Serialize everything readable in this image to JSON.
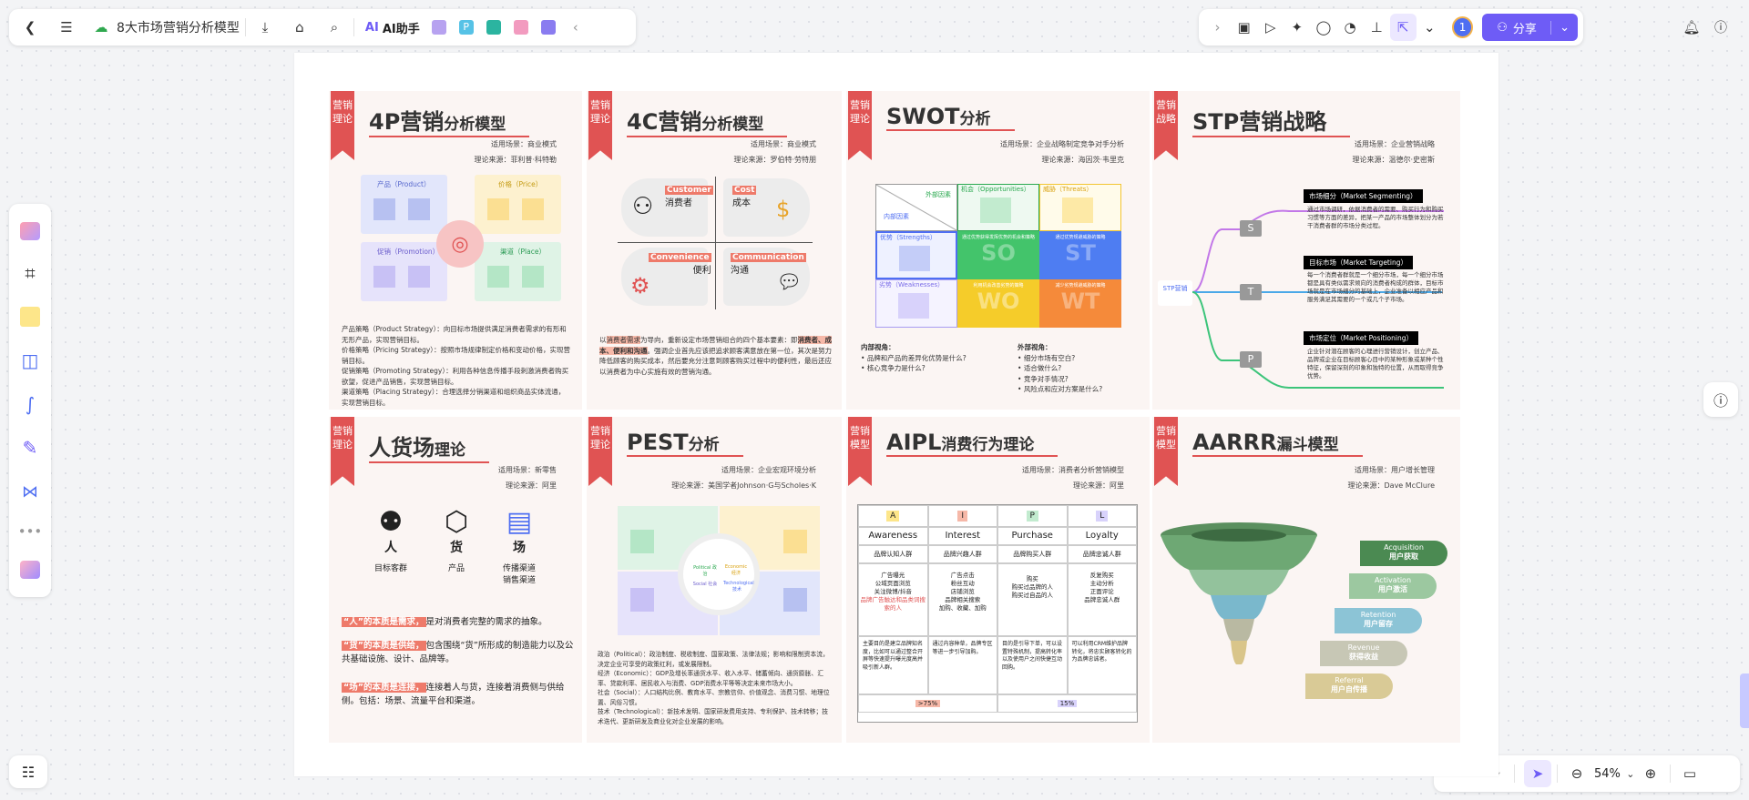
{
  "toolbar": {
    "doc_title": "8大市场营销分析模型",
    "ai_label": "AI助手",
    "share_label": "分享",
    "avatar_text": "1"
  },
  "zoom": {
    "level": "54%"
  },
  "cards": {
    "c1": {
      "ribbon": "营销理论",
      "title": "4P营销",
      "title_small": "分析模型",
      "meta1": "适用场景：商业模式",
      "meta2": "理论来源：菲利普·科特勒",
      "q1": "产品（Product）",
      "q2": "价格（Price）",
      "q3": "促销（Promotion）",
      "q4": "渠道（Place）",
      "d1": "产品策略（Product Strategy）：向目标市场提供满足消费者需求的有形和无形产品，实现营销目标。",
      "d2": "价格策略（Pricing Strategy）：按照市场规律制定价格和变动价格，实现营销目标。",
      "d3": "促销策略（Promoting Strategy）：利用各种信息传播手段刺激消费者购买欲望，促进产品销售，实现营销目标。",
      "d4": "渠道策略（Placing Strategy）：合理选择分销渠道和组织商品实体流通，实现营销目标。"
    },
    "c2": {
      "ribbon": "营销理论",
      "title": "4C营销",
      "title_small": "分析模型",
      "meta1": "适用场景：商业模式",
      "meta2": "理论来源：罗伯特·劳特朋",
      "q1en": "Customer",
      "q1": "消费者",
      "q2en": "Cost",
      "q2": "成本",
      "q3en": "Convenience",
      "q3": "便利",
      "q4en": "Communication",
      "q4": "沟通",
      "d_pre": "以",
      "d_h1": "消费者需求",
      "d_mid": "为导向，重新设定市场营销组合的四个基本要素：即",
      "d_h2": "消费者、成本、便利和沟通",
      "d_post": "。强调企业首先应该把追求顾客满意放在第一位，其次是努力降低顾客的购买成本，然后要充分注意到顾客购买过程中的便利性，最后还应以消费者为中心实施有效的营销沟通。"
    },
    "c3": {
      "ribbon": "营销理论",
      "title": "SWOT",
      "title_small": "分析",
      "meta1": "适用场景：企业战略制定竞争对手分析",
      "meta2": "理论来源：海因茨·韦里克",
      "ext": "外部因素",
      "int": "内部因素",
      "o": "机会（Opportunities）",
      "t": "威胁（Threats）",
      "s": "优势（Strengths）",
      "w": "劣势（Weaknesses）",
      "so_t": "通过优势获得发挥优势的机会和策略",
      "st_t": "通过优势规避威胁的策略",
      "wo_t": "利用机会改善劣势的策略",
      "wt_t": "减少劣势规避威胁的策略",
      "so": "SO",
      "st": "ST",
      "wo": "WO",
      "wt": "WT",
      "inner_h": "内部视角：",
      "inner1": "品牌和产品的差异化优势是什么?",
      "inner2": "核心竞争力是什么?",
      "outer_h": "外部视角：",
      "outer1": "细分市场有空白?",
      "outer2": "适合做什么?",
      "outer3": "竞争对手情况?",
      "outer4": "风险点和应对方案是什么?"
    },
    "c4": {
      "ribbon": "营销战略",
      "title": "STP营销战略",
      "meta1": "适用场景：企业营销战略",
      "meta2": "理论来源：温德尔·史密斯",
      "center": "STP营销",
      "l1": "S",
      "l2": "T",
      "l3": "P",
      "s_t": "市场细分（Market Segmenting）",
      "s_d": "通过市场调研，依据消费者的需要、购买行为和购买习惯等方面的差异，把某一产品的市场整体划分为若干消费者群的市场分类过程。",
      "t_t": "目标市场（Market Targeting）",
      "t_d": "每一个消费者群就是一个细分市场，每一个细分市场都是具有类似需求倾向的消费者构成的群体，目标市场就是在市场细分的基础上，企业准备以相应产品和服务满足其需要的一个或几个子市场。",
      "p_t": "市场定位（Market Positioning）",
      "p_d": "企业针对潜在顾客的心理进行营销设计，创立产品、品牌或企业在目标顾客心目中的某种形象或某种个性特征，保留深刻的印象和独特的位置，从而取得竞争优势。"
    },
    "c5": {
      "ribbon": "营销理论",
      "title": "人货场",
      "title_small": "理论",
      "meta1": "适用场景：新零售",
      "meta2": "理论来源：阿里",
      "r": "人",
      "r_sub": "目标客群",
      "h": "货",
      "h_sub": "产品",
      "c": "场",
      "c_sub1": "传播渠道",
      "c_sub2": "销售渠道",
      "p1h": "“人”的本质是需求，",
      "p1": "是对消费者完整的需求的抽象。",
      "p2h": "“货”的本质是供给，",
      "p2": "包含围绕“货”所形成的制造能力以及公共基础设施、设计、品牌等。",
      "p3h": "“场”的本质是连接，",
      "p3": "连接着人与货，连接着消费侧与供给侧。包括：场景、流量平台和渠道。"
    },
    "c6": {
      "ribbon": "营销理论",
      "title": "PEST",
      "title_small": "分析",
      "meta1": "适用场景：企业宏观环境分析",
      "meta2": "理论来源：美国学者Johnson·G与Scholes·K",
      "d1": "政治（Political）：政治制度、税收制度、国家政策、法律法规；影响和限制资本流，决定企业可享受的政策红利，或发展限制。",
      "d2": "经济（Economic）：GDP及增长率通货水平、收入水平、储蓄倾向、通货膨胀、汇率、贷款利率、居民收入与消费、GDP消费水平等等决定未来市场大小。",
      "d3": "社会（Social）：人口结构比例、教育水平、宗教信仰、价值观念、消费习惯、地理位置、风俗习惯。",
      "d4": "技术（Technological）：新技术发明、国家研发费用支持、专利保护、技术转移；技术迭代、更新研发及商业化对企业发展的影响。",
      "c1": "Political 政治",
      "c2": "Economic 经济",
      "c3": "Social 社会",
      "c4": "Technological 技术"
    },
    "c7": {
      "ribbon": "营销模型",
      "title": "AIPL",
      "title_small": "消费行为理论",
      "meta1": "适用场景：消费者分析营销模型",
      "meta2": "理论来源：阿里",
      "cols": [
        {
          "letter": "A",
          "en": "Awareness",
          "cn": "品牌认知人群",
          "acts": [
            "广告曝光",
            "公域页面浏览",
            "关注微博/抖音",
            "品牌广告触达和品类词搜索的人"
          ],
          "note": "主要目的是建立品牌知名度，比如可以通过整合开屏等快速提升曝光度高并吸引新人群。"
        },
        {
          "letter": "I",
          "en": "Interest",
          "cn": "品牌兴趣人群",
          "acts": [
            "广告点击",
            "粉丝互动",
            "店铺浏览",
            "品牌相关搜索",
            "加购、收藏、加购"
          ],
          "note": "通过内容种草，品牌专区等进一步引导加购。"
        },
        {
          "letter": "P",
          "en": "Purchase",
          "cn": "品牌购买人群",
          "acts": [
            "购买",
            "购买过品牌的人",
            "购买过自品的人"
          ],
          "note": "目的是引导下单，可以设置特殊机制，提高转化率以及使用户之间快捷互动回购。"
        },
        {
          "letter": "L",
          "en": "Loyalty",
          "cn": "品牌忠诚人群",
          "acts": [
            "反复购买",
            "主动分析",
            "正面评论",
            "品牌忠诚人群"
          ],
          "note": "可以利用CRM维护品牌转化，将忠实顾客转化的为品牌忠诚者。"
        }
      ],
      "pct1": ">75%",
      "pct2": "15%"
    },
    "c8": {
      "ribbon": "营销模型",
      "title": "AARRR",
      "title_small": "漏斗模型",
      "meta1": "适用场景：用户增长管理",
      "meta2": "理论来源：Dave McClure",
      "stages": [
        {
          "en": "Acquisition",
          "cn": "用户获取"
        },
        {
          "en": "Activation",
          "cn": "用户激活"
        },
        {
          "en": "Retention",
          "cn": "用户留存"
        },
        {
          "en": "Revenue",
          "cn": "获得收益"
        },
        {
          "en": "Referral",
          "cn": "用户自传播"
        }
      ]
    }
  },
  "colors": {
    "accent": "#e05353",
    "brand": "#6e5cf6"
  }
}
